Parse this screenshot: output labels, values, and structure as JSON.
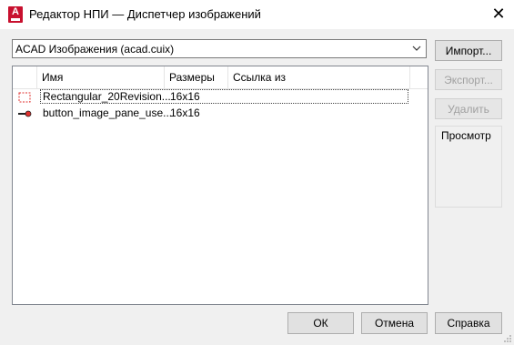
{
  "window": {
    "title": "Редактор НПИ — Диспетчер изображений",
    "app_icon_letter": "A"
  },
  "source": {
    "selected": "ACAD Изображения (acad.cuix)"
  },
  "list": {
    "columns": [
      "Имя",
      "Размеры",
      "Ссылка из"
    ],
    "rows": [
      {
        "name": "Rectangular_20Revision...",
        "size": "16x16",
        "ref": "",
        "icon": "dashed-rectangle-icon"
      },
      {
        "name": "button_image_pane_use...",
        "size": "16x16",
        "ref": "",
        "icon": "tool-pin-icon"
      }
    ]
  },
  "side_buttons": {
    "import": "Импорт...",
    "export": "Экспорт...",
    "delete": "Удалить"
  },
  "preview": {
    "label": "Просмотр"
  },
  "footer": {
    "ok": "ОК",
    "cancel": "Отмена",
    "help": "Справка"
  },
  "colors": {
    "app_icon": "#c8102e",
    "revision_icon": "#e0312f"
  }
}
